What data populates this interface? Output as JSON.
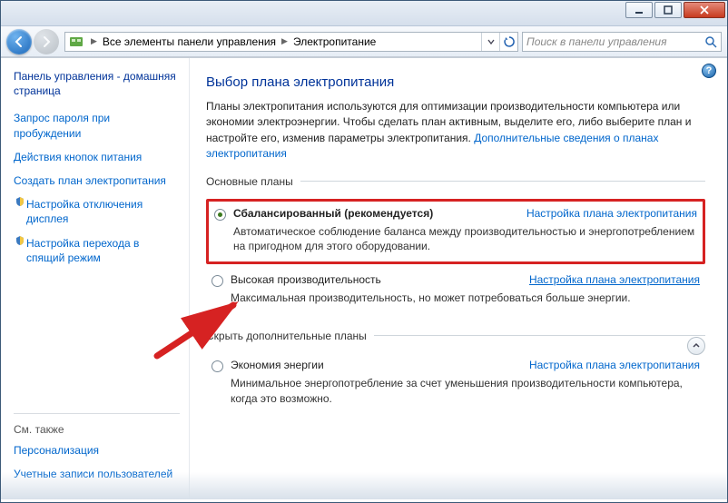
{
  "breadcrumb": {
    "root": "Все элементы панели управления",
    "current": "Электропитание"
  },
  "search": {
    "placeholder": "Поиск в панели управления"
  },
  "sidebar": {
    "home": "Панель управления - домашняя страница",
    "links": [
      "Запрос пароля при пробуждении",
      "Действия кнопок питания",
      "Создать план электропитания",
      "Настройка отключения дисплея",
      "Настройка перехода в спящий режим"
    ],
    "also_hdr": "См. также",
    "also": [
      "Персонализация",
      "Учетные записи пользователей"
    ]
  },
  "main": {
    "title": "Выбор плана электропитания",
    "intro_1": "Планы электропитания используются для оптимизации производительности компьютера или экономии электроэнергии. Чтобы сделать план активным, выделите его, либо выберите план и настройте его, изменив параметры электропитания. ",
    "intro_link": "Дополнительные сведения о планах электропитания",
    "group_main": "Основные планы",
    "group_extra": "Скрыть дополнительные планы",
    "plan_settings": "Настройка плана электропитания",
    "plans": {
      "balanced": {
        "title": "Сбалансированный (рекомендуется)",
        "desc": "Автоматическое соблюдение баланса между производительностью и энергопотреблением на пригодном для этого оборудовании."
      },
      "high": {
        "title": "Высокая производительность",
        "desc": "Максимальная производительность, но может потребоваться больше энергии."
      },
      "eco": {
        "title": "Экономия энергии",
        "desc": "Минимальное энергопотребление за счет уменьшения производительности компьютера, когда это возможно."
      }
    }
  }
}
